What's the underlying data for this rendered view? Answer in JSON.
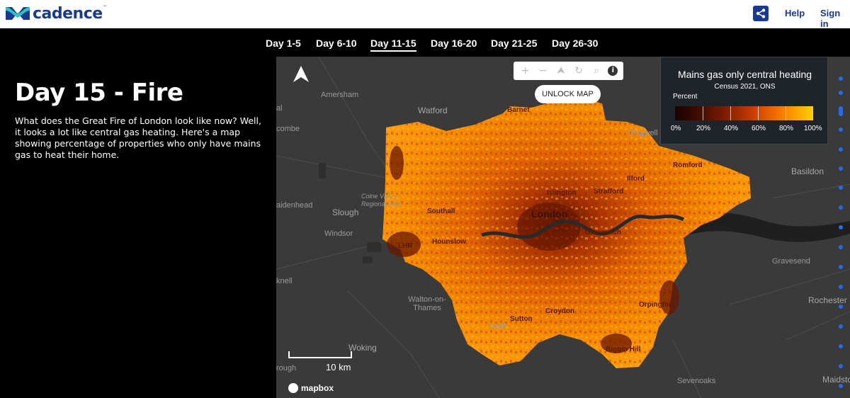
{
  "brand": {
    "name": "cadence",
    "tm": "™",
    "logo_icon": "cadence-wave-logo"
  },
  "header": {
    "share_icon": "share-icon",
    "help_label": "Help",
    "signin_label": "Sign in",
    "accent": "#1a3a8f"
  },
  "tabs": [
    {
      "label": "Day 1-5"
    },
    {
      "label": "Day 6-10"
    },
    {
      "label": "Day 11-15",
      "active": true
    },
    {
      "label": "Day 16-20"
    },
    {
      "label": "Day 21-25"
    },
    {
      "label": "Day 26-30"
    }
  ],
  "panel": {
    "title": "Day 15 - Fire",
    "description": "What does the Great Fire of London look like now? Well, it looks a lot like central gas heating. Here's a map showing percentage of properties who only have mains gas to heat their home."
  },
  "map": {
    "toolbar": {
      "zoom_in": "+",
      "zoom_out": "−",
      "compass": "⮝",
      "reset": "↻",
      "search": "⌕",
      "info": "i"
    },
    "unlock_label": "UNLOCK MAP",
    "scale_label": "10 km",
    "attribution": "mapbox",
    "places_outer": [
      "Amersham",
      "Watford",
      "Chigwell",
      "Basildon",
      "Slough",
      "Windsor",
      "Gravesend",
      "Walton-on-\nThames",
      "Ewell",
      "Woking",
      "Rochester",
      "Sevenoaks",
      "Maidston",
      "Colne Valley\nRegional Park",
      "aidenhead",
      "combe",
      "knell",
      "rough",
      "al"
    ],
    "places_inner": [
      "Barnet",
      "Romford",
      "Ilford",
      "Islington",
      "Stratford",
      "Southall",
      "Hounslow",
      "Greenwich",
      "LHR",
      "Sutton",
      "Croydon",
      "Orpington",
      "Biggin Hill"
    ],
    "city": "London"
  },
  "legend": {
    "title": "Mains gas only central heating",
    "subtitle": "Census 2021, ONS",
    "unit": "Percent",
    "labels": [
      "0%",
      "20%",
      "40%",
      "60%",
      "80%",
      "100%"
    ],
    "colors": [
      "#1a0500",
      "#7a1c00",
      "#c43a00",
      "#f06a00",
      "#ff9a00",
      "#ffd200"
    ]
  }
}
